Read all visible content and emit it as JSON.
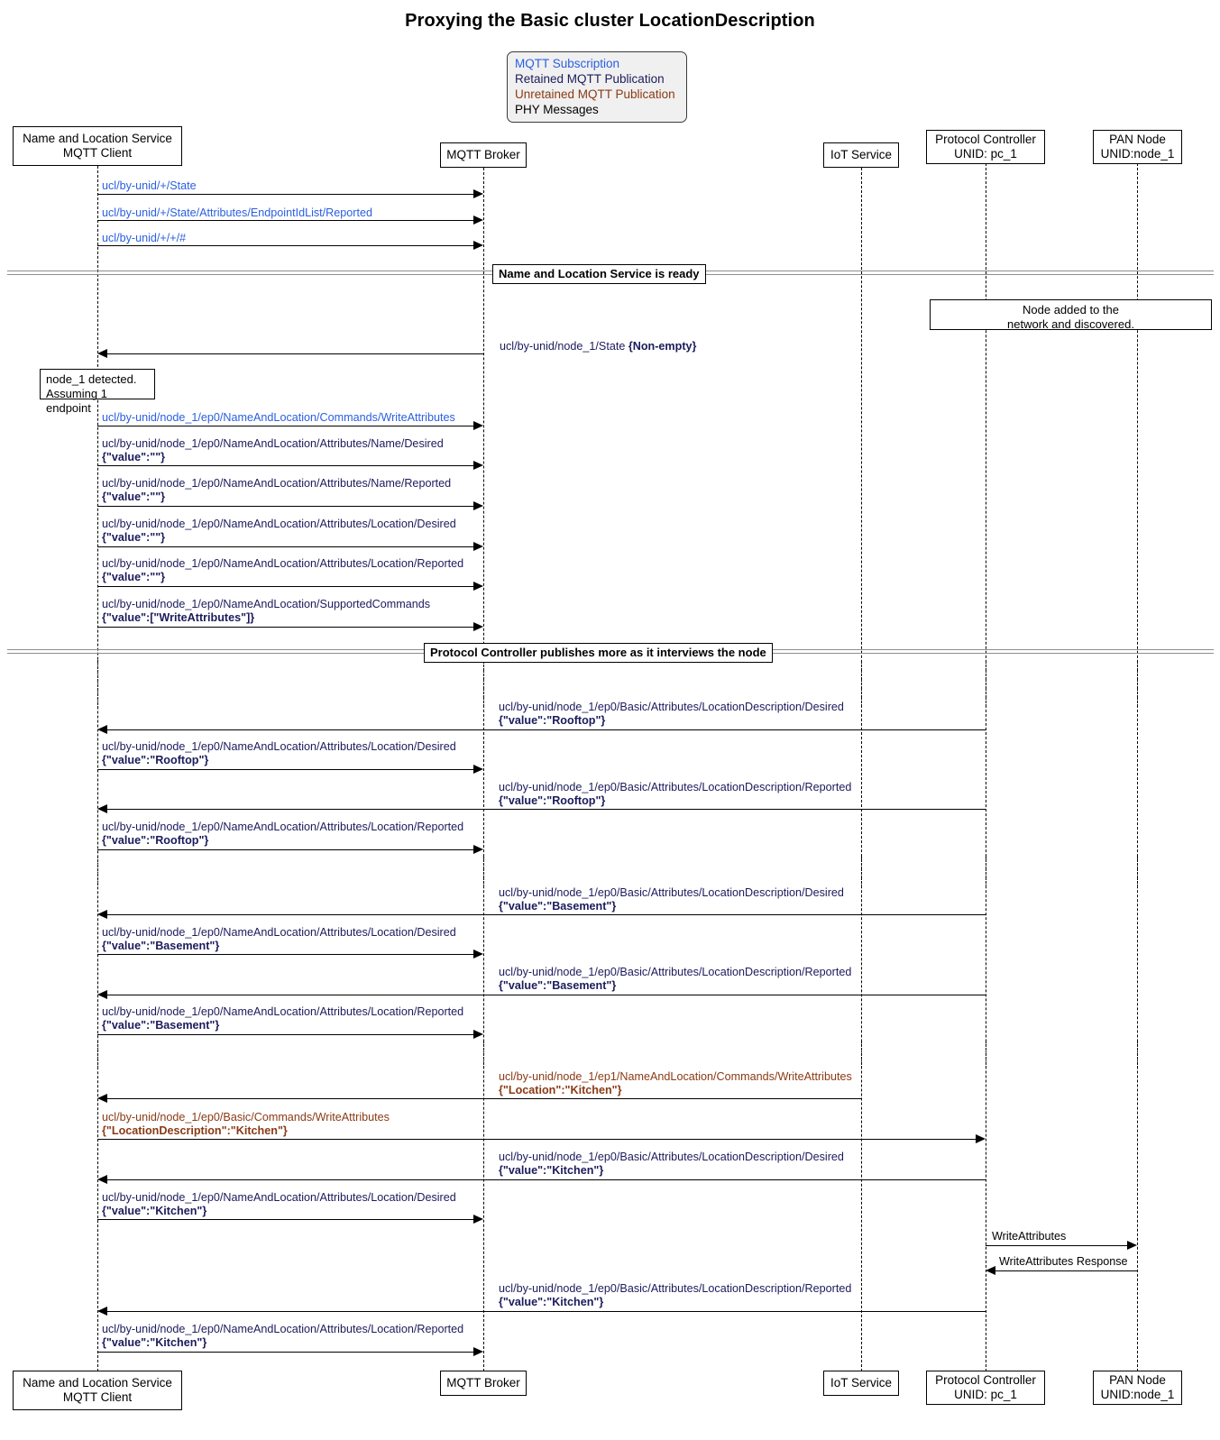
{
  "title": "Proxying the Basic cluster LocationDescription",
  "legend": {
    "items": [
      {
        "label": "MQTT Subscription",
        "color": "#2a5fe0",
        "kind": "subscription"
      },
      {
        "label": "Retained MQTT Publication",
        "color": "#1b1b5c",
        "kind": "retained"
      },
      {
        "label": "Unretained MQTT Publication",
        "color": "#8a3a14",
        "kind": "unretained"
      },
      {
        "label": "PHY Messages",
        "color": "#000000",
        "kind": "phy"
      }
    ]
  },
  "participants": [
    {
      "id": "nls",
      "line1": "Name and Location Service",
      "line2": "MQTT Client"
    },
    {
      "id": "broker",
      "line1": "MQTT Broker",
      "line2": ""
    },
    {
      "id": "iot",
      "line1": "IoT Service",
      "line2": ""
    },
    {
      "id": "pc",
      "line1": "Protocol Controller",
      "line2": "UNID: pc_1"
    },
    {
      "id": "pan",
      "line1": "PAN Node",
      "line2": "UNID:node_1"
    }
  ],
  "dividers": [
    {
      "label": "Name and Location Service is ready"
    },
    {
      "label": "Protocol Controller publishes more as it interviews the node"
    }
  ],
  "notes": [
    {
      "id": "node-added",
      "text": "Node added to the\nnetwork and discovered."
    },
    {
      "id": "node-detected",
      "text": "node_1 detected.\nAssuming 1 endpoint"
    }
  ],
  "messages": [
    {
      "topic": "ucl/by-unid/+/State",
      "payload": "",
      "kind": "subscription",
      "from": "nls",
      "to": "broker",
      "dir": "right"
    },
    {
      "topic": "ucl/by-unid/+/State/Attributes/EndpointIdList/Reported",
      "payload": "",
      "kind": "subscription",
      "from": "nls",
      "to": "broker",
      "dir": "right"
    },
    {
      "topic": "ucl/by-unid/+/+/#",
      "payload": "",
      "kind": "subscription",
      "from": "nls",
      "to": "broker",
      "dir": "right"
    },
    {
      "topic": "ucl/by-unid/node_1/State",
      "payload": "{Non-empty}",
      "kind": "retained",
      "from": "broker",
      "to": "nls",
      "dir": "left",
      "inline": true
    },
    {
      "topic": "ucl/by-unid/node_1/ep0/NameAndLocation/Commands/WriteAttributes",
      "payload": "",
      "kind": "subscription",
      "from": "nls",
      "to": "broker",
      "dir": "right"
    },
    {
      "topic": "ucl/by-unid/node_1/ep0/NameAndLocation/Attributes/Name/Desired",
      "payload": "{\"value\":\"\"}",
      "kind": "retained",
      "from": "nls",
      "to": "broker",
      "dir": "right"
    },
    {
      "topic": "ucl/by-unid/node_1/ep0/NameAndLocation/Attributes/Name/Reported",
      "payload": "{\"value\":\"\"}",
      "kind": "retained",
      "from": "nls",
      "to": "broker",
      "dir": "right"
    },
    {
      "topic": "ucl/by-unid/node_1/ep0/NameAndLocation/Attributes/Location/Desired",
      "payload": "{\"value\":\"\"}",
      "kind": "retained",
      "from": "nls",
      "to": "broker",
      "dir": "right"
    },
    {
      "topic": "ucl/by-unid/node_1/ep0/NameAndLocation/Attributes/Location/Reported",
      "payload": "{\"value\":\"\"}",
      "kind": "retained",
      "from": "nls",
      "to": "broker",
      "dir": "right"
    },
    {
      "topic": "ucl/by-unid/node_1/ep0/NameAndLocation/SupportedCommands",
      "payload": "{\"value\":[\"WriteAttributes\"]}",
      "kind": "retained",
      "from": "nls",
      "to": "broker",
      "dir": "right"
    },
    {
      "topic": "ucl/by-unid/node_1/ep0/Basic/Attributes/LocationDescription/Desired",
      "payload": "{\"value\":\"Rooftop\"}",
      "kind": "retained",
      "from": "pc",
      "to": "nls",
      "dir": "left"
    },
    {
      "topic": "ucl/by-unid/node_1/ep0/NameAndLocation/Attributes/Location/Desired",
      "payload": "{\"value\":\"Rooftop\"}",
      "kind": "retained",
      "from": "nls",
      "to": "broker",
      "dir": "right"
    },
    {
      "topic": "ucl/by-unid/node_1/ep0/Basic/Attributes/LocationDescription/Reported",
      "payload": "{\"value\":\"Rooftop\"}",
      "kind": "retained",
      "from": "pc",
      "to": "nls",
      "dir": "left"
    },
    {
      "topic": "ucl/by-unid/node_1/ep0/NameAndLocation/Attributes/Location/Reported",
      "payload": "{\"value\":\"Rooftop\"}",
      "kind": "retained",
      "from": "nls",
      "to": "broker",
      "dir": "right"
    },
    {
      "topic": "ucl/by-unid/node_1/ep0/Basic/Attributes/LocationDescription/Desired",
      "payload": "{\"value\":\"Basement\"}",
      "kind": "retained",
      "from": "pc",
      "to": "nls",
      "dir": "left"
    },
    {
      "topic": "ucl/by-unid/node_1/ep0/NameAndLocation/Attributes/Location/Desired",
      "payload": "{\"value\":\"Basement\"}",
      "kind": "retained",
      "from": "nls",
      "to": "broker",
      "dir": "right"
    },
    {
      "topic": "ucl/by-unid/node_1/ep0/Basic/Attributes/LocationDescription/Reported",
      "payload": "{\"value\":\"Basement\"}",
      "kind": "retained",
      "from": "pc",
      "to": "nls",
      "dir": "left"
    },
    {
      "topic": "ucl/by-unid/node_1/ep0/NameAndLocation/Attributes/Location/Reported",
      "payload": "{\"value\":\"Basement\"}",
      "kind": "retained",
      "from": "nls",
      "to": "broker",
      "dir": "right"
    },
    {
      "topic": "ucl/by-unid/node_1/ep1/NameAndLocation/Commands/WriteAttributes",
      "payload": "{\"Location\":\"Kitchen\"}",
      "kind": "unretained",
      "from": "iot",
      "to": "nls",
      "dir": "left"
    },
    {
      "topic": "ucl/by-unid/node_1/ep0/Basic/Commands/WriteAttributes",
      "payload": "{\"LocationDescription\":\"Kitchen\"}",
      "kind": "unretained",
      "from": "nls",
      "to": "pc",
      "dir": "right"
    },
    {
      "topic": "ucl/by-unid/node_1/ep0/Basic/Attributes/LocationDescription/Desired",
      "payload": "{\"value\":\"Kitchen\"}",
      "kind": "retained",
      "from": "pc",
      "to": "nls",
      "dir": "left"
    },
    {
      "topic": "ucl/by-unid/node_1/ep0/NameAndLocation/Attributes/Location/Desired",
      "payload": "{\"value\":\"Kitchen\"}",
      "kind": "retained",
      "from": "nls",
      "to": "broker",
      "dir": "right"
    },
    {
      "topic": "WriteAttributes",
      "payload": "",
      "kind": "phy",
      "from": "pc",
      "to": "pan",
      "dir": "right"
    },
    {
      "topic": "WriteAttributes Response",
      "payload": "",
      "kind": "phy",
      "from": "pan",
      "to": "pc",
      "dir": "left"
    },
    {
      "topic": "ucl/by-unid/node_1/ep0/Basic/Attributes/LocationDescription/Reported",
      "payload": "{\"value\":\"Kitchen\"}",
      "kind": "retained",
      "from": "pc",
      "to": "nls",
      "dir": "left"
    },
    {
      "topic": "ucl/by-unid/node_1/ep0/NameAndLocation/Attributes/Location/Reported",
      "payload": "{\"value\":\"Kitchen\"}",
      "kind": "retained",
      "from": "nls",
      "to": "broker",
      "dir": "right"
    }
  ]
}
